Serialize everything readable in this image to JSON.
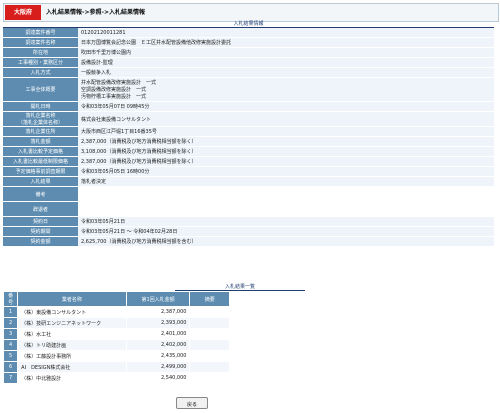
{
  "header": {
    "org": "大阪府",
    "breadcrumb": "入札結果情報->参照->入札結果情報"
  },
  "section_title": "入札結果情報",
  "details": [
    {
      "label": "調達案件番号",
      "value": "01202120011281"
    },
    {
      "label": "調達案件名称",
      "value": "日本万国博覧会記念公園　Ｅ工区井水配管設備他改修実施設計委託"
    },
    {
      "label": "所在地",
      "value": "吹田市千里万博公園内"
    },
    {
      "label": "工事種別・業務区分",
      "value": "設備設計-監理"
    },
    {
      "label": "入札方式",
      "value": "一般競争入札"
    },
    {
      "label": "工事全体概要",
      "value": "井水配管設備改修実施設計　一式\n空調設備改修実施設計　一式\n汚物貯槽工事実施設計　一式"
    },
    {
      "label": "開札日時",
      "value": "令和03年05月07日 09時45分"
    },
    {
      "label": "落札企業名称\n（落札企業体名称）",
      "value": "株式会社東設備コンサルタント"
    },
    {
      "label": "落札企業住所",
      "value": "大阪市西区江戸堀1丁目16番35号"
    },
    {
      "label": "落札金額",
      "value": "2,387,000（消費税及び地方消費税相当額を除く）"
    },
    {
      "label": "入札書比較予定価格",
      "value": "3,108,000（消費税及び地方消費税相当額を除く）"
    },
    {
      "label": "入札書比較最低制限価格",
      "value": "2,387,000（消費税及び地方消費税相当額を除く）"
    },
    {
      "label": "予定価格事前調査期限",
      "value": "令和03年05月05日 16時00分"
    },
    {
      "label": "入札結果",
      "value": "落札者決定"
    },
    {
      "label": "備考",
      "value": ""
    },
    {
      "label": "辞退者",
      "value": ""
    },
    {
      "label": "契約日",
      "value": "令和03年05月21日"
    },
    {
      "label": "契約期間",
      "value": "令和03年05月21日 ～ 令和04年02月28日"
    },
    {
      "label": "契約金額",
      "value": "2,625,700（消費税及び地方消費税相当額を含む）"
    }
  ],
  "results": {
    "title": "入札結果一覧",
    "headers": [
      "番号",
      "業者名称",
      "第1回入札金額",
      "摘要"
    ],
    "rows": [
      {
        "no": "1",
        "name": "（株）東設備コンサルタント",
        "amount": "2,387,000",
        "note": ""
      },
      {
        "no": "2",
        "name": "（株）技研エンジニアネットワーク",
        "amount": "2,393,000",
        "note": ""
      },
      {
        "no": "3",
        "name": "（株）水工社",
        "amount": "2,401,000",
        "note": ""
      },
      {
        "no": "4",
        "name": "（株）トリ助建計画",
        "amount": "2,402,000",
        "note": ""
      },
      {
        "no": "5",
        "name": "（株）工藤設計事務所",
        "amount": "2,435,000",
        "note": ""
      },
      {
        "no": "6",
        "name": "AI　DESIGN株式会社",
        "amount": "2,499,000",
        "note": ""
      },
      {
        "no": "7",
        "name": "（株）中北雅設計",
        "amount": "2,540,000",
        "note": ""
      }
    ]
  },
  "back_label": "戻る"
}
